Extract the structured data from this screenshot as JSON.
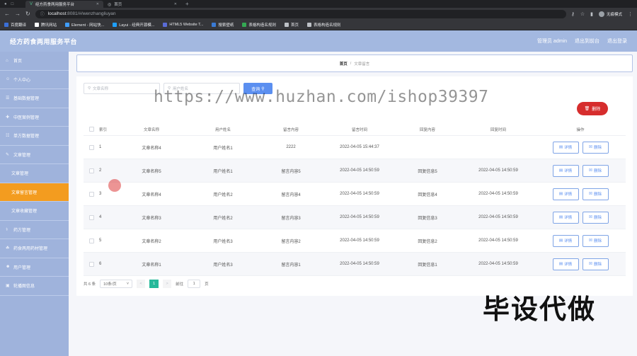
{
  "browser": {
    "tabs": [
      {
        "title": "经方药食两用服务平台",
        "icon": "vue-icon",
        "active": true
      },
      {
        "title": "首页",
        "icon": "globe-icon",
        "active": false
      }
    ],
    "url_host": "localhost",
    "url_path": ":8081/#/wenzhangliuyan",
    "profile_label": "无痕模式",
    "bookmarks": [
      {
        "label": "百度翻译",
        "color": "#3b6fd6"
      },
      {
        "label": "腾讯网站",
        "color": "#ffffff"
      },
      {
        "label": "Element - 网站快...",
        "color": "#409eff"
      },
      {
        "label": "Layui - 经典开源模...",
        "color": "#1e9fff"
      },
      {
        "label": "HTML5 Website T...",
        "color": "#5a6cd6"
      },
      {
        "label": "搜索壁纸",
        "color": "#3a7bd5"
      },
      {
        "label": "表格构造名规则",
        "color": "#34a853"
      },
      {
        "label": "首页",
        "color": "#bdc1c6"
      },
      {
        "label": "表格构造名规则",
        "color": "#bdc1c6"
      }
    ]
  },
  "header": {
    "title": "经方药食两用服务平台",
    "admin_label": "管理员 admin",
    "backend_label": "退出到前台",
    "logout_label": "退出登录"
  },
  "sidebar": {
    "items": [
      {
        "label": "首页",
        "sub": false,
        "active": false
      },
      {
        "label": "个人中心",
        "sub": false,
        "active": false
      },
      {
        "label": "基础数据管理",
        "sub": false,
        "active": false
      },
      {
        "label": "中医案例管理",
        "sub": false,
        "active": false
      },
      {
        "label": "单方数据管理",
        "sub": false,
        "active": false
      },
      {
        "label": "文章管理",
        "sub": false,
        "active": false
      },
      {
        "label": "文章管理",
        "sub": true,
        "active": false
      },
      {
        "label": "文章留言管理",
        "sub": true,
        "active": true
      },
      {
        "label": "文章收藏管理",
        "sub": true,
        "active": false
      },
      {
        "label": "药方管理",
        "sub": false,
        "active": false
      },
      {
        "label": "药食两用药材管理",
        "sub": false,
        "active": false
      },
      {
        "label": "用户管理",
        "sub": false,
        "active": false
      },
      {
        "label": "轮播图信息",
        "sub": false,
        "active": false
      }
    ]
  },
  "breadcrumb": {
    "home": "首页",
    "sep": "/",
    "current": "文章留言"
  },
  "search": {
    "field1_placeholder": "文章名称",
    "field2_placeholder": "用户姓名",
    "button_label": "查询"
  },
  "toolbar": {
    "delete_label": "删除"
  },
  "table": {
    "headers": [
      "索引",
      "文章名称",
      "用户姓名",
      "留言内容",
      "留言时间",
      "回复内容",
      "回复时间",
      "操作"
    ],
    "detail_label": "详情",
    "delete_label": "删除",
    "rows": [
      {
        "index": "1",
        "article": "文章名称4",
        "user": "用户姓名1",
        "content": "2222",
        "time": "2022-04-05 15:44:37",
        "reply": "",
        "reply_time": ""
      },
      {
        "index": "2",
        "article": "文章名称5",
        "user": "用户姓名1",
        "content": "留言内容5",
        "time": "2022-04-05 14:50:59",
        "reply": "回复信息5",
        "reply_time": "2022-04-05 14:50:59"
      },
      {
        "index": "3",
        "article": "文章名称4",
        "user": "用户姓名2",
        "content": "留言内容4",
        "time": "2022-04-05 14:50:59",
        "reply": "回复信息4",
        "reply_time": "2022-04-05 14:50:59"
      },
      {
        "index": "4",
        "article": "文章名称3",
        "user": "用户姓名2",
        "content": "留言内容3",
        "time": "2022-04-05 14:50:59",
        "reply": "回复信息3",
        "reply_time": "2022-04-05 14:50:59"
      },
      {
        "index": "5",
        "article": "文章名称2",
        "user": "用户姓名3",
        "content": "留言内容2",
        "time": "2022-04-05 14:50:59",
        "reply": "回复信息2",
        "reply_time": "2022-04-05 14:50:59"
      },
      {
        "index": "6",
        "article": "文章名称1",
        "user": "用户姓名3",
        "content": "留言内容1",
        "time": "2022-04-05 14:50:59",
        "reply": "回复信息1",
        "reply_time": "2022-04-05 14:50:59"
      }
    ]
  },
  "pagination": {
    "total_label": "共 6 条",
    "page_size": "10条/页",
    "prev": "<",
    "current_page": "1",
    "next": ">",
    "goto_label": "前往",
    "goto_value": "1",
    "page_suffix": "页"
  },
  "watermark": "https://www.huzhan.com/ishop39397",
  "overlay_text": "毕设代做"
}
